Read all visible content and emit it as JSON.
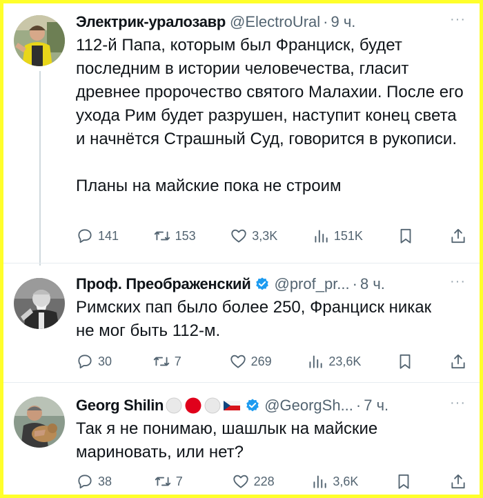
{
  "tweets": [
    {
      "name": "Электрик-уралозавр",
      "handle": "@ElectroUral",
      "dot": "·",
      "time": "9 ч.",
      "more": "···",
      "paragraphs": [
        "112-й Папа, которым был Франциск, будет последним в истории человечества, гласит древнее пророчество святого Малахии. После его ухода Рим будет разрушен, наступит конец света и начнётся Страшный Суд, говорится в рукописи.",
        "Планы на майские пока не строим"
      ],
      "replies": "141",
      "retweets": "153",
      "likes": "3,3K",
      "views": "151K"
    },
    {
      "name": "Проф. Преображенский",
      "handle": "@prof_pr...",
      "dot": "·",
      "time": "8 ч.",
      "more": "···",
      "paragraphs": [
        "Римских пап было более 250, Франциск никак не мог быть 112-м."
      ],
      "replies": "30",
      "retweets": "7",
      "likes": "269",
      "views": "23,6K"
    },
    {
      "name": "Georg Shilin",
      "handle": "@GeorgSh...",
      "dot": "·",
      "time": "7 ч.",
      "more": "···",
      "paragraphs": [
        "Так я не понимаю, шашлык на майские мариновать, или нет?"
      ],
      "replies": "38",
      "retweets": "7",
      "likes": "228",
      "views": "3,6K"
    }
  ],
  "colors": {
    "frame": "#ffff2a",
    "text": "#0f1419",
    "secondary": "#536471",
    "verified": "#1d9bf0",
    "red": "#e0001b"
  },
  "icons": [
    "reply-icon",
    "retweet-icon",
    "like-icon",
    "views-icon",
    "bookmark-icon",
    "share-icon",
    "verified-icon"
  ]
}
